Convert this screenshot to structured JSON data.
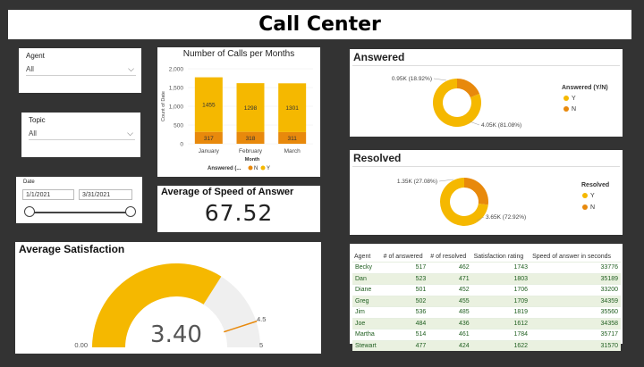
{
  "title": "Call Center",
  "colors": {
    "yes": "#f5b800",
    "no": "#e8890c",
    "track": "#efefef",
    "table_text": "#1f5e1f",
    "table_alt": "#eaf1e0"
  },
  "agent_slicer": {
    "label": "Agent",
    "value": "All"
  },
  "topic_slicer": {
    "label": "Topic",
    "value": "All"
  },
  "date_slicer": {
    "label": "Date",
    "start": "1/1/2021",
    "end": "3/31/2021",
    "range_fraction": [
      0,
      1
    ]
  },
  "calls_chart": {
    "title": "Number of Calls per Months",
    "xlabel": "Month",
    "ylabel": "Count of Date",
    "legend_title": "Answered (...",
    "legend_items": [
      "N",
      "Y"
    ],
    "yticks": [
      "0",
      "500",
      "1,000",
      "1,500",
      "2,000"
    ]
  },
  "speed": {
    "title": "Average of Speed of Answer",
    "value": "67.52"
  },
  "satisfaction": {
    "title": "Average Satisfaction",
    "value": "3.40",
    "min": "0.00",
    "max": "5",
    "target": "4.5",
    "value_num": 3.4,
    "min_num": 0,
    "max_num": 5,
    "target_num": 4.5
  },
  "answered": {
    "title": "Answered",
    "legend_title": "Answered (Y/N)",
    "legend_items": [
      "Y",
      "N"
    ],
    "label_y": "4.05K (81.08%)",
    "label_n": "0.95K (18.92%)"
  },
  "resolved": {
    "title": "Resolved",
    "legend_title": "Resolved",
    "legend_items": [
      "Y",
      "N"
    ],
    "label_y": "3.65K (72.92%)",
    "label_n": "1.35K (27.08%)"
  },
  "table": {
    "headers": [
      "Agent",
      "# of answered",
      "# of resolved",
      "Satisfaction rating",
      "Speed of answer in seconds"
    ],
    "rows": [
      [
        "Becky",
        "517",
        "462",
        "1743",
        "33776"
      ],
      [
        "Dan",
        "523",
        "471",
        "1803",
        "35189"
      ],
      [
        "Diane",
        "501",
        "452",
        "1706",
        "33200"
      ],
      [
        "Greg",
        "502",
        "455",
        "1709",
        "34359"
      ],
      [
        "Jim",
        "536",
        "485",
        "1819",
        "35560"
      ],
      [
        "Joe",
        "484",
        "436",
        "1612",
        "34358"
      ],
      [
        "Martha",
        "514",
        "461",
        "1784",
        "35717"
      ],
      [
        "Stewart",
        "477",
        "424",
        "1622",
        "31570"
      ]
    ]
  },
  "chart_data": [
    {
      "type": "bar",
      "title": "Number of Calls per Months",
      "xlabel": "Month",
      "ylabel": "Count of Date",
      "categories": [
        "January",
        "February",
        "March"
      ],
      "series": [
        {
          "name": "N",
          "values": [
            317,
            318,
            311
          ]
        },
        {
          "name": "Y",
          "values": [
            1455,
            1298,
            1301
          ]
        }
      ],
      "ylim": [
        0,
        2000
      ],
      "stacked": true,
      "legend": "bottom"
    },
    {
      "type": "pie",
      "title": "Answered",
      "categories": [
        "Y",
        "N"
      ],
      "values": [
        4050,
        950
      ],
      "percent": [
        81.08,
        18.92
      ],
      "legend": "right"
    },
    {
      "type": "pie",
      "title": "Resolved",
      "categories": [
        "Y",
        "N"
      ],
      "values": [
        3650,
        1350
      ],
      "percent": [
        72.92,
        27.08
      ],
      "legend": "right"
    }
  ]
}
